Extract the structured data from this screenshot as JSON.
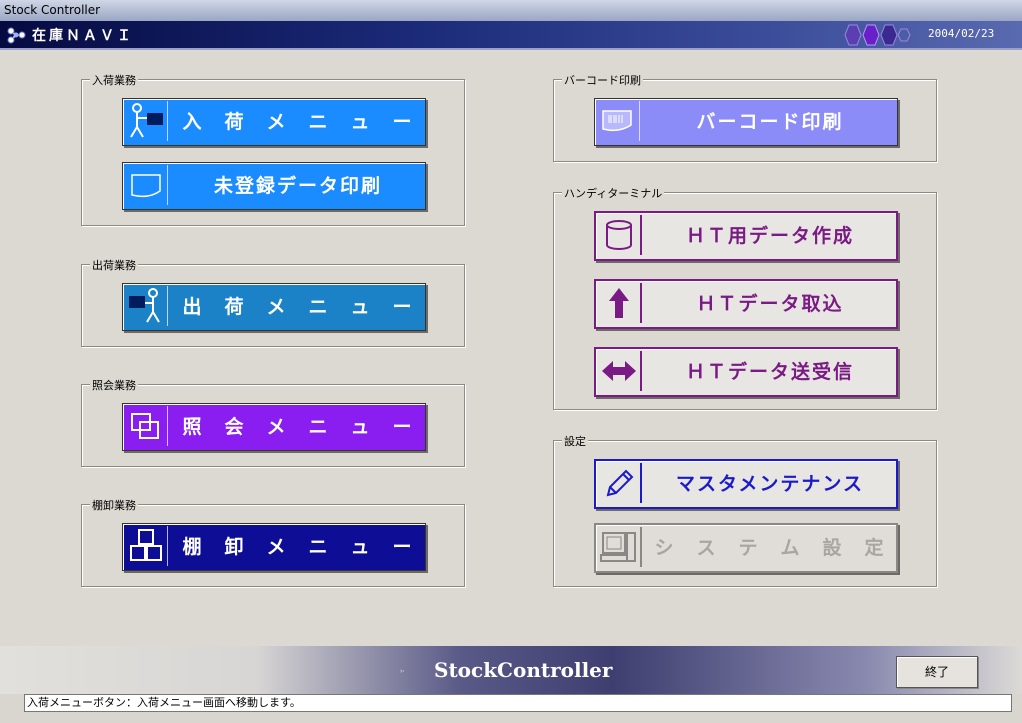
{
  "window": {
    "title": "Stock Controller"
  },
  "header": {
    "app_title": "在庫ＮＡＶＩ",
    "date": "2004/02/23"
  },
  "groups": {
    "receiving": {
      "legend": "入荷業務",
      "buttons": [
        {
          "label": "入　荷　メ　ニ　ュ　ー",
          "icon": "person-receiving-icon"
        },
        {
          "label": "未登録データ印刷",
          "icon": "document-icon"
        }
      ]
    },
    "shipping": {
      "legend": "出荷業務",
      "buttons": [
        {
          "label": "出　荷　メ　ニ　ュ　ー",
          "icon": "person-shipping-icon"
        }
      ]
    },
    "inquiry": {
      "legend": "照会業務",
      "buttons": [
        {
          "label": "照　会　メ　ニ　ュ　ー",
          "icon": "windows-icon"
        }
      ]
    },
    "inventory": {
      "legend": "棚卸業務",
      "buttons": [
        {
          "label": "棚　卸　メ　ニ　ュ　ー",
          "icon": "boxes-icon"
        }
      ]
    },
    "barcode": {
      "legend": "バーコード印刷",
      "buttons": [
        {
          "label": "バーコード印刷",
          "icon": "barcode-icon"
        }
      ]
    },
    "handy": {
      "legend": "ハンディターミナル",
      "buttons": [
        {
          "label": "ＨＴ用データ作成",
          "icon": "database-icon"
        },
        {
          "label": "ＨＴデータ取込",
          "icon": "arrow-up-icon"
        },
        {
          "label": "ＨＴデータ送受信",
          "icon": "arrow-both-icon"
        }
      ]
    },
    "settings": {
      "legend": "設定",
      "buttons": [
        {
          "label": "マスタメンテナンス",
          "icon": "pencil-icon"
        },
        {
          "label": "シ　ス　テ　ム　設　定",
          "icon": "computer-icon"
        }
      ]
    }
  },
  "footer": {
    "brand": "StockController",
    "exit_label": "終了"
  },
  "status": {
    "text": "入荷メニューボタン：入荷メニュー画面へ移動します。"
  },
  "colors": {
    "receiving": "#1a8cff",
    "shipping": "#1c82c8",
    "inquiry": "#8a1ef0",
    "inventory": "#0d0d96",
    "barcode": "#8c8cf8",
    "handy": "#7a1a84",
    "master": "#1a1acc"
  }
}
